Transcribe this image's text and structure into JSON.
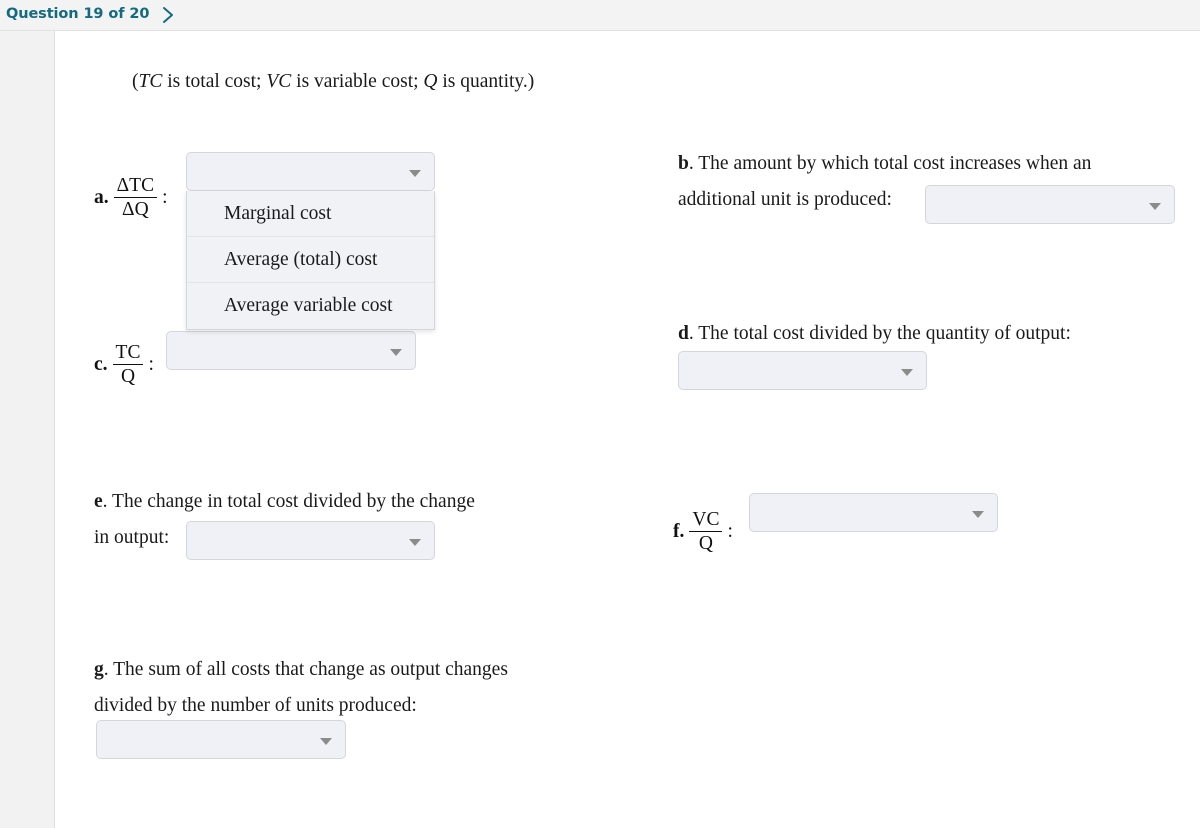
{
  "header": {
    "counter_label": "Question 19 of 20",
    "next_icon": "chevron-right-icon",
    "accent_color": "#136b7f"
  },
  "intro": {
    "open_paren": "(",
    "tc_symbol": "TC",
    "tc_text": " is total cost; ",
    "vc_symbol": "VC",
    "vc_text": " is variable cost; ",
    "q_symbol": "Q",
    "q_text": " is quantity.)"
  },
  "items": {
    "a": {
      "letter": "a.",
      "numerator": "ΔTC",
      "denominator": "ΔQ",
      "colon": ":",
      "select_value": ""
    },
    "b": {
      "letter": "b",
      "line1": ". The amount by which total cost increases when an",
      "line2": "additional unit is produced:",
      "select_value": ""
    },
    "c": {
      "letter": "c.",
      "numerator": "TC",
      "denominator": "Q",
      "colon": ":",
      "select_value": ""
    },
    "d": {
      "letter": "d",
      "line1": ". The total cost divided by the quantity of output:",
      "select_value": ""
    },
    "e": {
      "letter": "e",
      "line1": ". The change in total cost divided by the change",
      "line2": "in output:",
      "select_value": ""
    },
    "f": {
      "letter": "f.",
      "numerator": "VC",
      "denominator": "Q",
      "colon": ":",
      "select_value": ""
    },
    "g": {
      "letter": "g",
      "line1": ". The sum of all costs that change as output changes",
      "line2": "divided by the number of units produced:",
      "select_value": ""
    }
  },
  "dropdown": {
    "open_for": "a",
    "options": [
      "Marginal cost",
      "Average (total) cost",
      "Average variable cost"
    ]
  },
  "colors": {
    "select_fill": "#f0f1f6",
    "select_border": "#d4d6dc",
    "gutter": "#f2f2f2",
    "header_bar": "#f3f3f3",
    "arrow": "#8b8b8b"
  }
}
